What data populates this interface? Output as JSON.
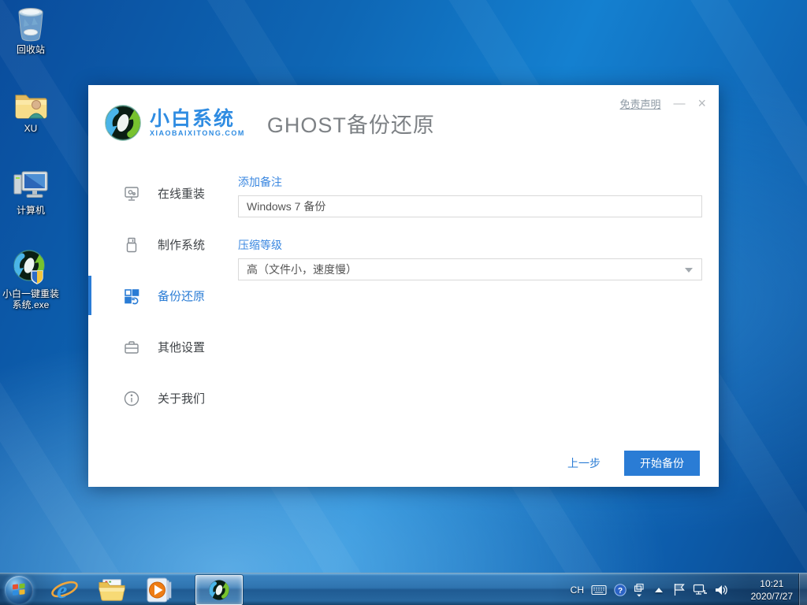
{
  "colors": {
    "accent": "#2a7cd5",
    "label_blue": "#3a87e0",
    "brand_blue": "#2f8ce2"
  },
  "desktop": {
    "icons": [
      {
        "label": "回收站",
        "icon": "recycle-bin-icon"
      },
      {
        "label": "XU",
        "icon": "user-folder-icon"
      },
      {
        "label": "计算机",
        "icon": "computer-icon"
      },
      {
        "label_line1": "小白一键重装",
        "label_line2": "系统.exe",
        "icon": "xiaobai-app-icon"
      }
    ]
  },
  "window": {
    "brand": {
      "name": "小白系统",
      "domain": "XIAOBAIXITONG.COM"
    },
    "title": "GHOST备份还原",
    "controls": {
      "disclaimer": "免责声明",
      "minimize": "—",
      "close": "×"
    },
    "sidebar": [
      {
        "label": "在线重装",
        "icon": "online-reinstall-icon"
      },
      {
        "label": "制作系统",
        "icon": "make-system-icon"
      },
      {
        "label": "备份还原",
        "icon": "backup-restore-icon"
      },
      {
        "label": "其他设置",
        "icon": "other-settings-icon"
      },
      {
        "label": "关于我们",
        "icon": "about-us-icon"
      }
    ],
    "form": {
      "note_label": "添加备注",
      "note_value": "Windows 7 备份",
      "compress_label": "压缩等级",
      "compress_value": "高（文件小，速度慢）"
    },
    "footer": {
      "back": "上一步",
      "start": "开始备份"
    }
  },
  "taskbar": {
    "tray": {
      "lang": "CH",
      "time": "10:21",
      "date": "2020/7/27"
    }
  }
}
